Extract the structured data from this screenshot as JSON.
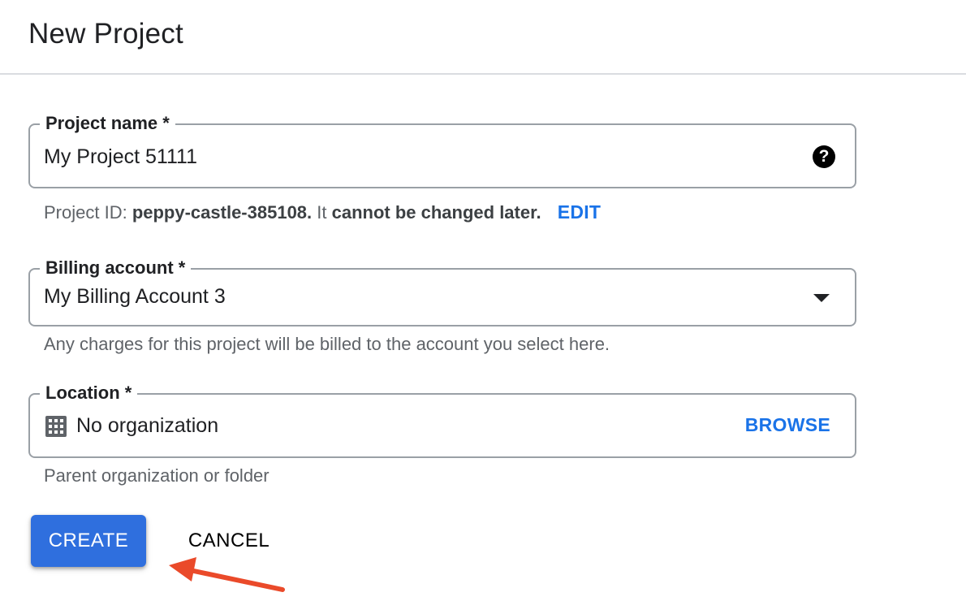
{
  "header": {
    "title": "New Project"
  },
  "project_name": {
    "label": "Project name *",
    "value": "My Project 51111",
    "help_icon": "question-circle-icon"
  },
  "project_id": {
    "prefix": "Project ID: ",
    "id": "peppy-castle-385108.",
    "middle": " It ",
    "warning": "cannot be changed later.",
    "edit_label": "EDIT"
  },
  "billing": {
    "label": "Billing account *",
    "value": "My Billing Account 3",
    "hint": "Any charges for this project will be billed to the account you select here.",
    "dropdown_icon": "triangle-down-icon"
  },
  "location": {
    "label": "Location *",
    "value": "No organization",
    "browse_label": "BROWSE",
    "hint": "Parent organization or folder",
    "icon": "building-icon"
  },
  "actions": {
    "create_label": "CREATE",
    "cancel_label": "CANCEL"
  },
  "colors": {
    "accent": "#1a73e8",
    "create_button": "#2f6fde",
    "annotation_arrow": "#ea4a2a"
  }
}
